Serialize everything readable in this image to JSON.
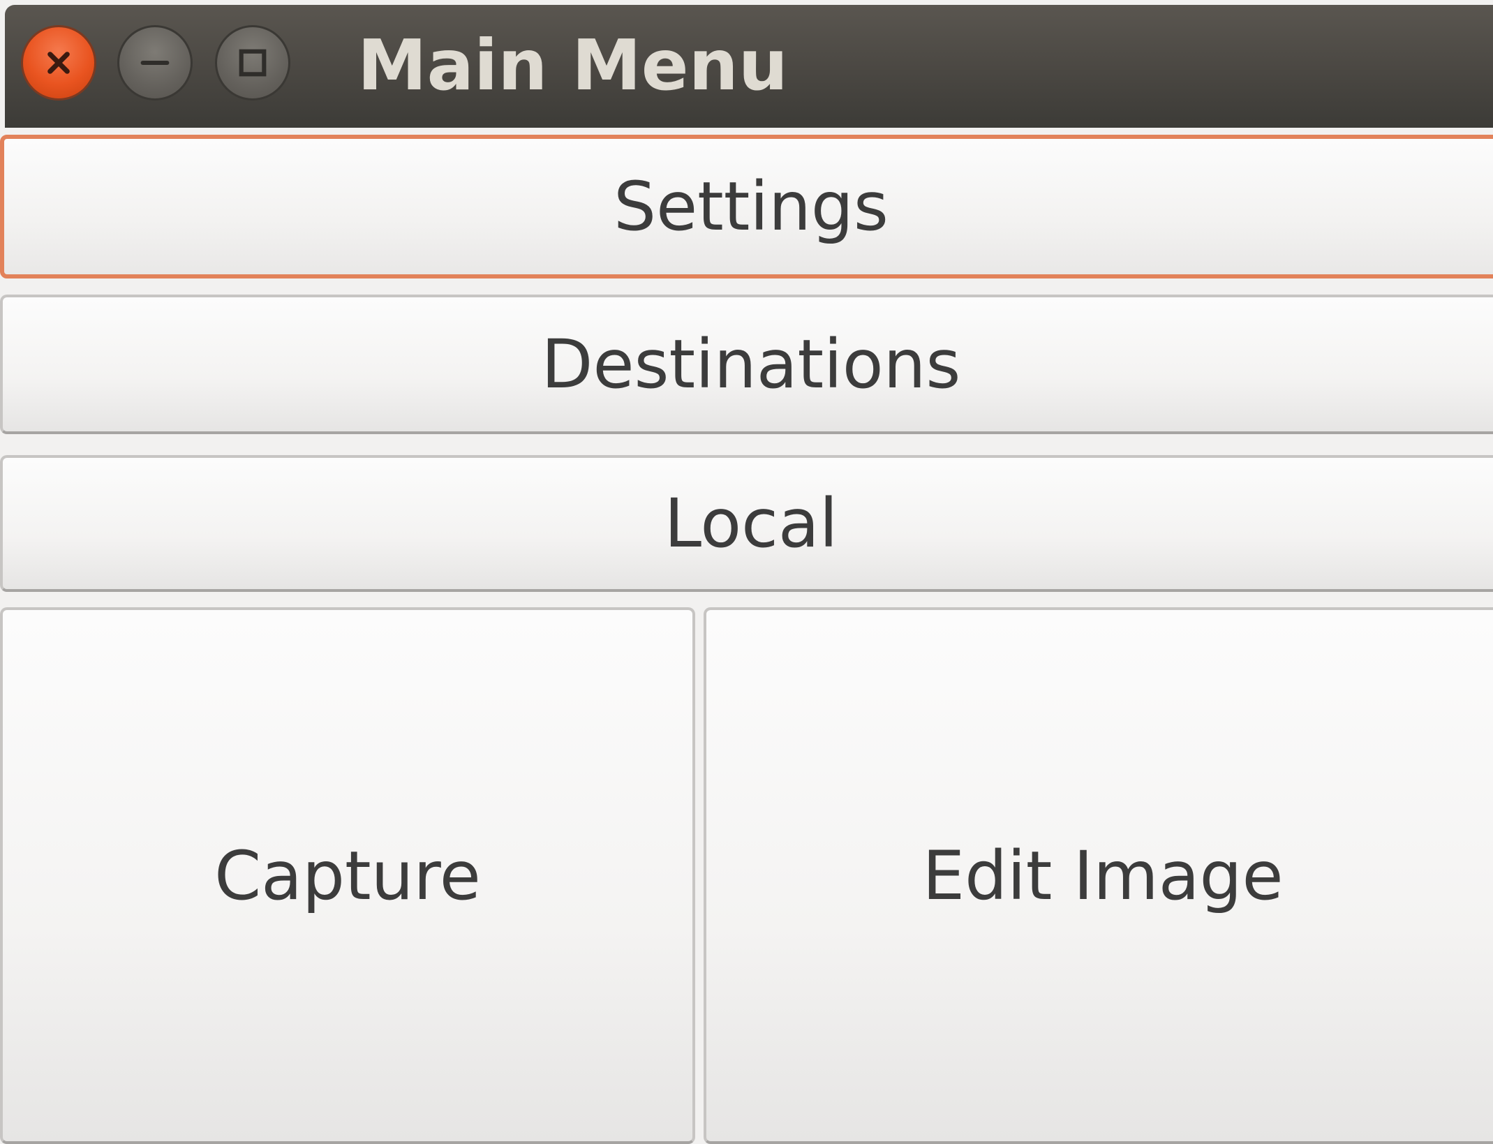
{
  "window": {
    "title": "Main Menu",
    "controls": [
      "close-icon",
      "minimize-icon",
      "maximize-icon"
    ],
    "accent_color": "#e95420"
  },
  "buttons": {
    "settings": "Settings",
    "destinations": "Destinations",
    "local": "Local",
    "capture": "Capture",
    "edit_image": "Edit Image"
  }
}
